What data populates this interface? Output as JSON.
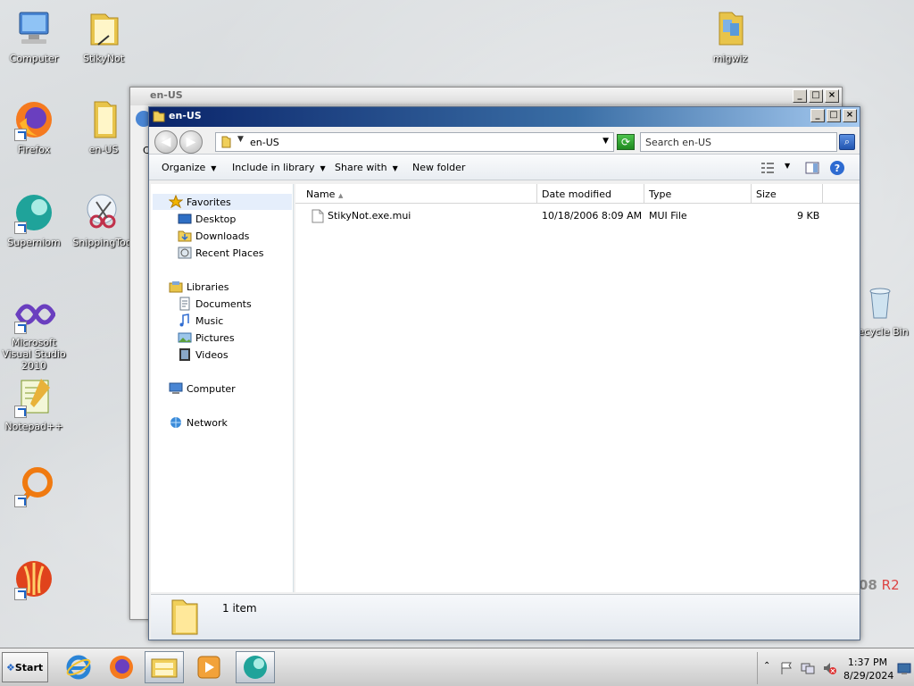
{
  "desktop": {
    "icons": [
      {
        "label": "Computer"
      },
      {
        "label": "StikyNot"
      },
      {
        "label": "migwiz"
      },
      {
        "label": "Firefox"
      },
      {
        "label": "en-US"
      },
      {
        "label": "Superniom"
      },
      {
        "label": "SnippingTool"
      },
      {
        "label": "Microsoft Visual Studio 2010"
      },
      {
        "label": "Notepad++"
      },
      {
        "label": "Recycle Bin"
      }
    ],
    "watermark": {
      "text": "08",
      "accent": "R2"
    }
  },
  "back_window": {
    "title": "en-US",
    "fragment": "C"
  },
  "window": {
    "title": "en-US",
    "address": {
      "path": "en-US",
      "search_placeholder": "Search en-US"
    },
    "toolbar": {
      "organize": "Organize",
      "include_in_library": "Include in library",
      "share_with": "Share with",
      "new_folder": "New folder"
    },
    "nav": {
      "favorites": "Favorites",
      "desktop": "Desktop",
      "downloads": "Downloads",
      "recent_places": "Recent Places",
      "libraries": "Libraries",
      "documents": "Documents",
      "music": "Music",
      "pictures": "Pictures",
      "videos": "Videos",
      "computer": "Computer",
      "network": "Network"
    },
    "columns": {
      "name": "Name",
      "date_modified": "Date modified",
      "type": "Type",
      "size": "Size"
    },
    "files": [
      {
        "name": "StikyNot.exe.mui",
        "date_modified": "10/18/2006 8:09 AM",
        "type": "MUI File",
        "size": "9 KB"
      }
    ],
    "status": "1 item"
  },
  "taskbar": {
    "start_label": "Start",
    "time": "1:37 PM",
    "date": "8/29/2024"
  },
  "colors": {
    "title_active": "#0a246a",
    "accent": "#3a6ea5"
  }
}
